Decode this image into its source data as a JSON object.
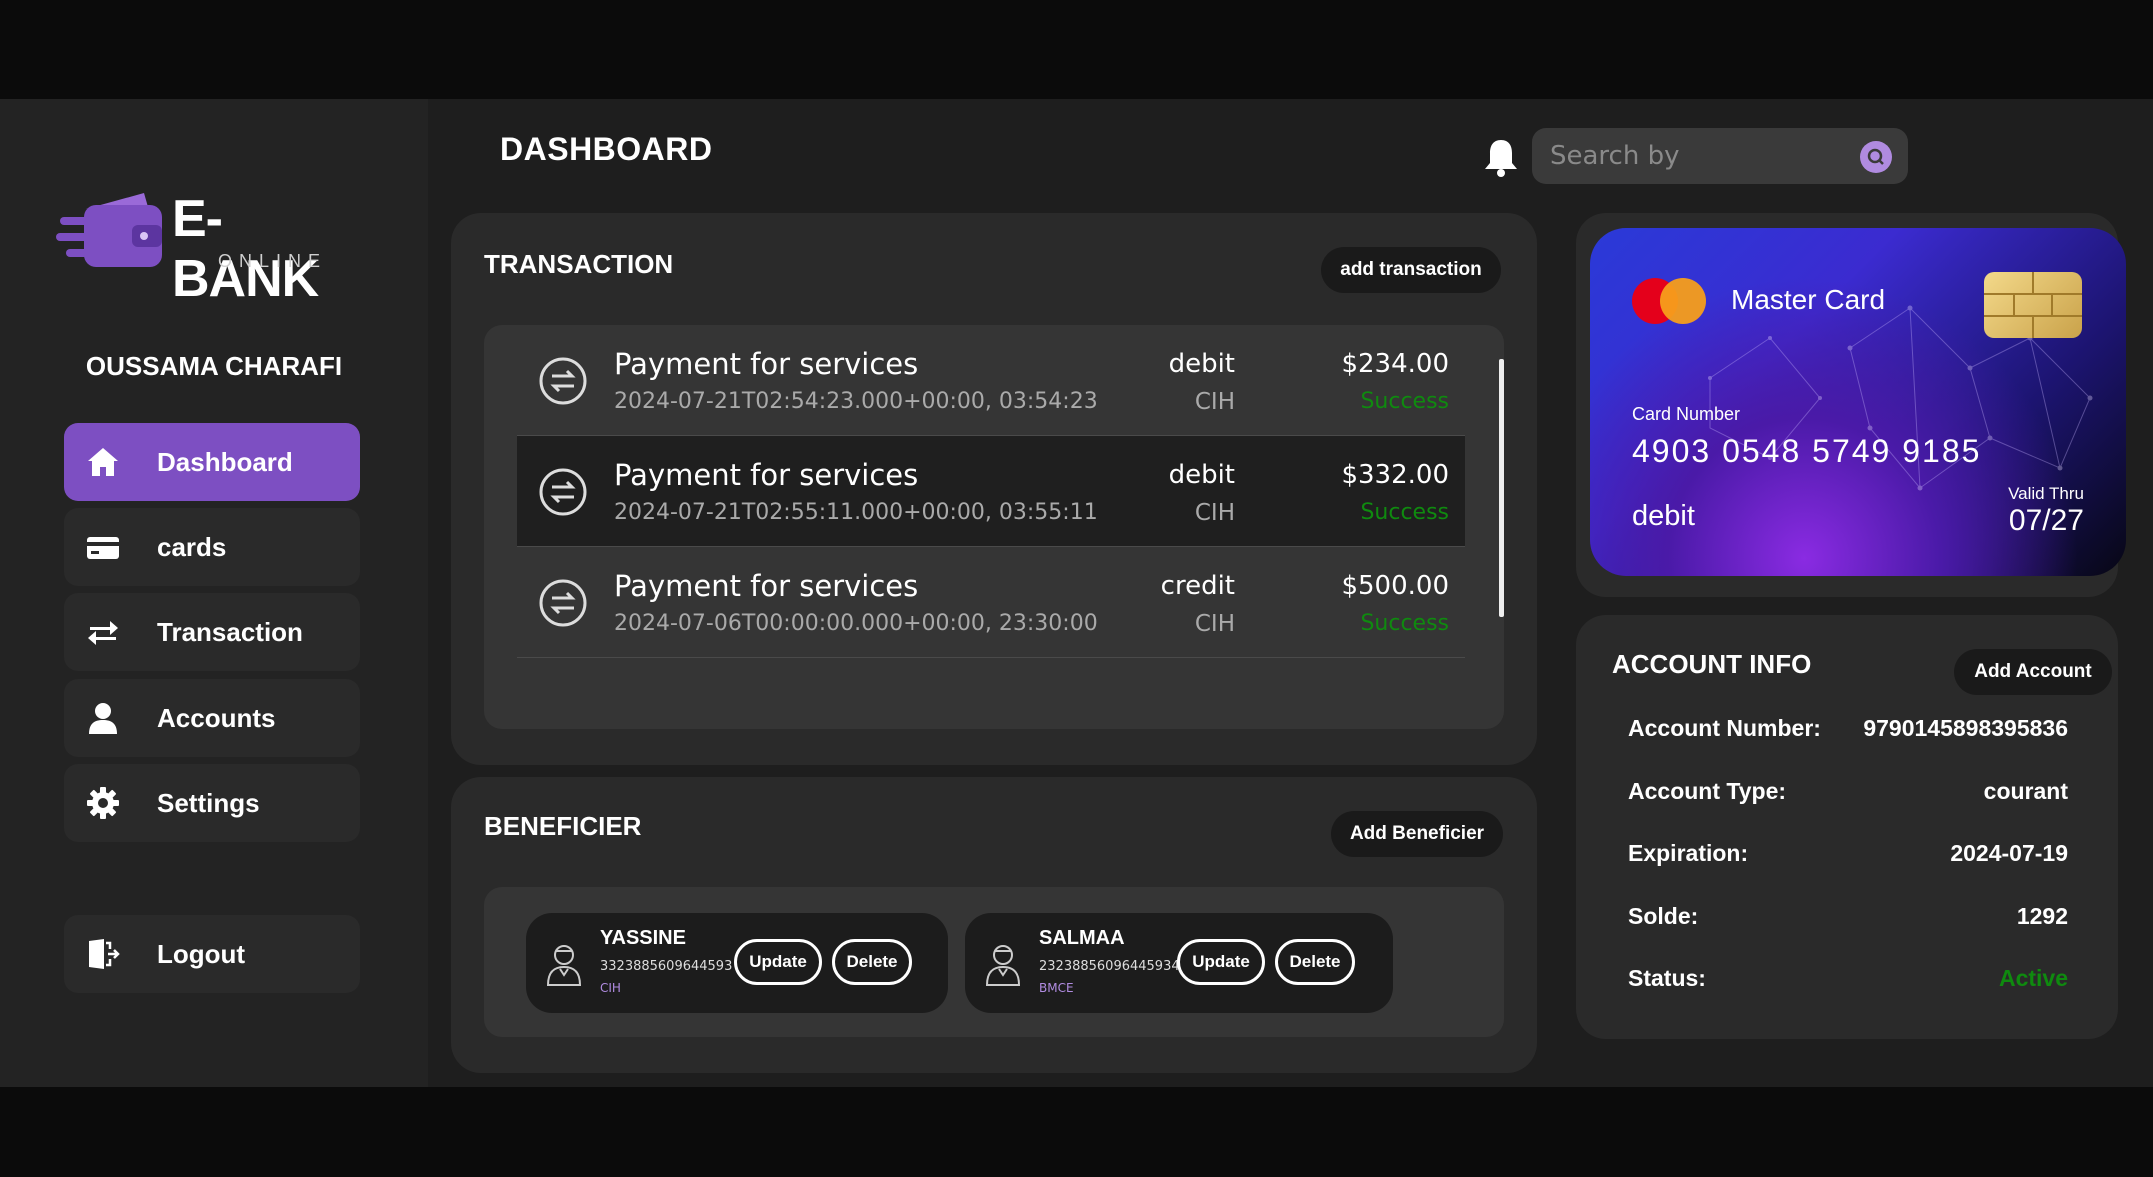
{
  "brand": {
    "name": "E-BANK",
    "tagline": "ONLINE",
    "accent": "#7d4fc2"
  },
  "user": {
    "name": "OUSSAMA CHARAFI"
  },
  "sidebar": {
    "items": [
      {
        "label": "Dashboard",
        "icon": "home-icon",
        "active": true
      },
      {
        "label": "cards",
        "icon": "card-icon"
      },
      {
        "label": "Transaction",
        "icon": "transfer-icon"
      },
      {
        "label": "Accounts",
        "icon": "user-icon"
      },
      {
        "label": "Settings",
        "icon": "gear-icon"
      }
    ],
    "logout": {
      "label": "Logout",
      "icon": "logout-icon"
    }
  },
  "header": {
    "title": "DASHBOARD",
    "search_placeholder": "Search by"
  },
  "transactions": {
    "title": "TRANSACTION",
    "add_label": "add transaction",
    "rows": [
      {
        "title": "Payment for services",
        "date": "2024-07-21T02:54:23.000+00:00, 03:54:23",
        "type": "debit",
        "bank": "CIH",
        "amount": "$234.00",
        "status": "Success"
      },
      {
        "title": "Payment for services",
        "date": "2024-07-21T02:55:11.000+00:00, 03:55:11",
        "type": "debit",
        "bank": "CIH",
        "amount": "$332.00",
        "status": "Success"
      },
      {
        "title": "Payment for services",
        "date": "2024-07-06T00:00:00.000+00:00, 23:30:00",
        "type": "credit",
        "bank": "CIH",
        "amount": "$500.00",
        "status": "Success"
      }
    ]
  },
  "beneficiaries": {
    "title": "BENEFICIER",
    "add_label": "Add Beneficier",
    "items": [
      {
        "name": "YASSINE",
        "number": "3323885609644593",
        "bank": "CIH",
        "update_label": "Update",
        "delete_label": "Delete"
      },
      {
        "name": "SALMAA",
        "number": "2323885609644593​4",
        "bank": "BMCE",
        "update_label": "Update",
        "delete_label": "Delete"
      }
    ]
  },
  "card": {
    "brand": "Master Card",
    "number_label": "Card Number",
    "number": "4903 0548 5749 9185",
    "type": "debit",
    "valid_label": "Valid Thru",
    "valid": "07/27"
  },
  "account": {
    "title": "ACCOUNT INFO",
    "add_label": "Add Account",
    "fields": [
      {
        "label": "Account Number:",
        "value": "9790145898395836"
      },
      {
        "label": "Account Type:",
        "value": "courant"
      },
      {
        "label": "Expiration:",
        "value": "2024-07-19"
      },
      {
        "label": "Solde:",
        "value": "1292"
      },
      {
        "label": "Status:",
        "value": "Active",
        "color": "#0f8a0f"
      }
    ]
  }
}
